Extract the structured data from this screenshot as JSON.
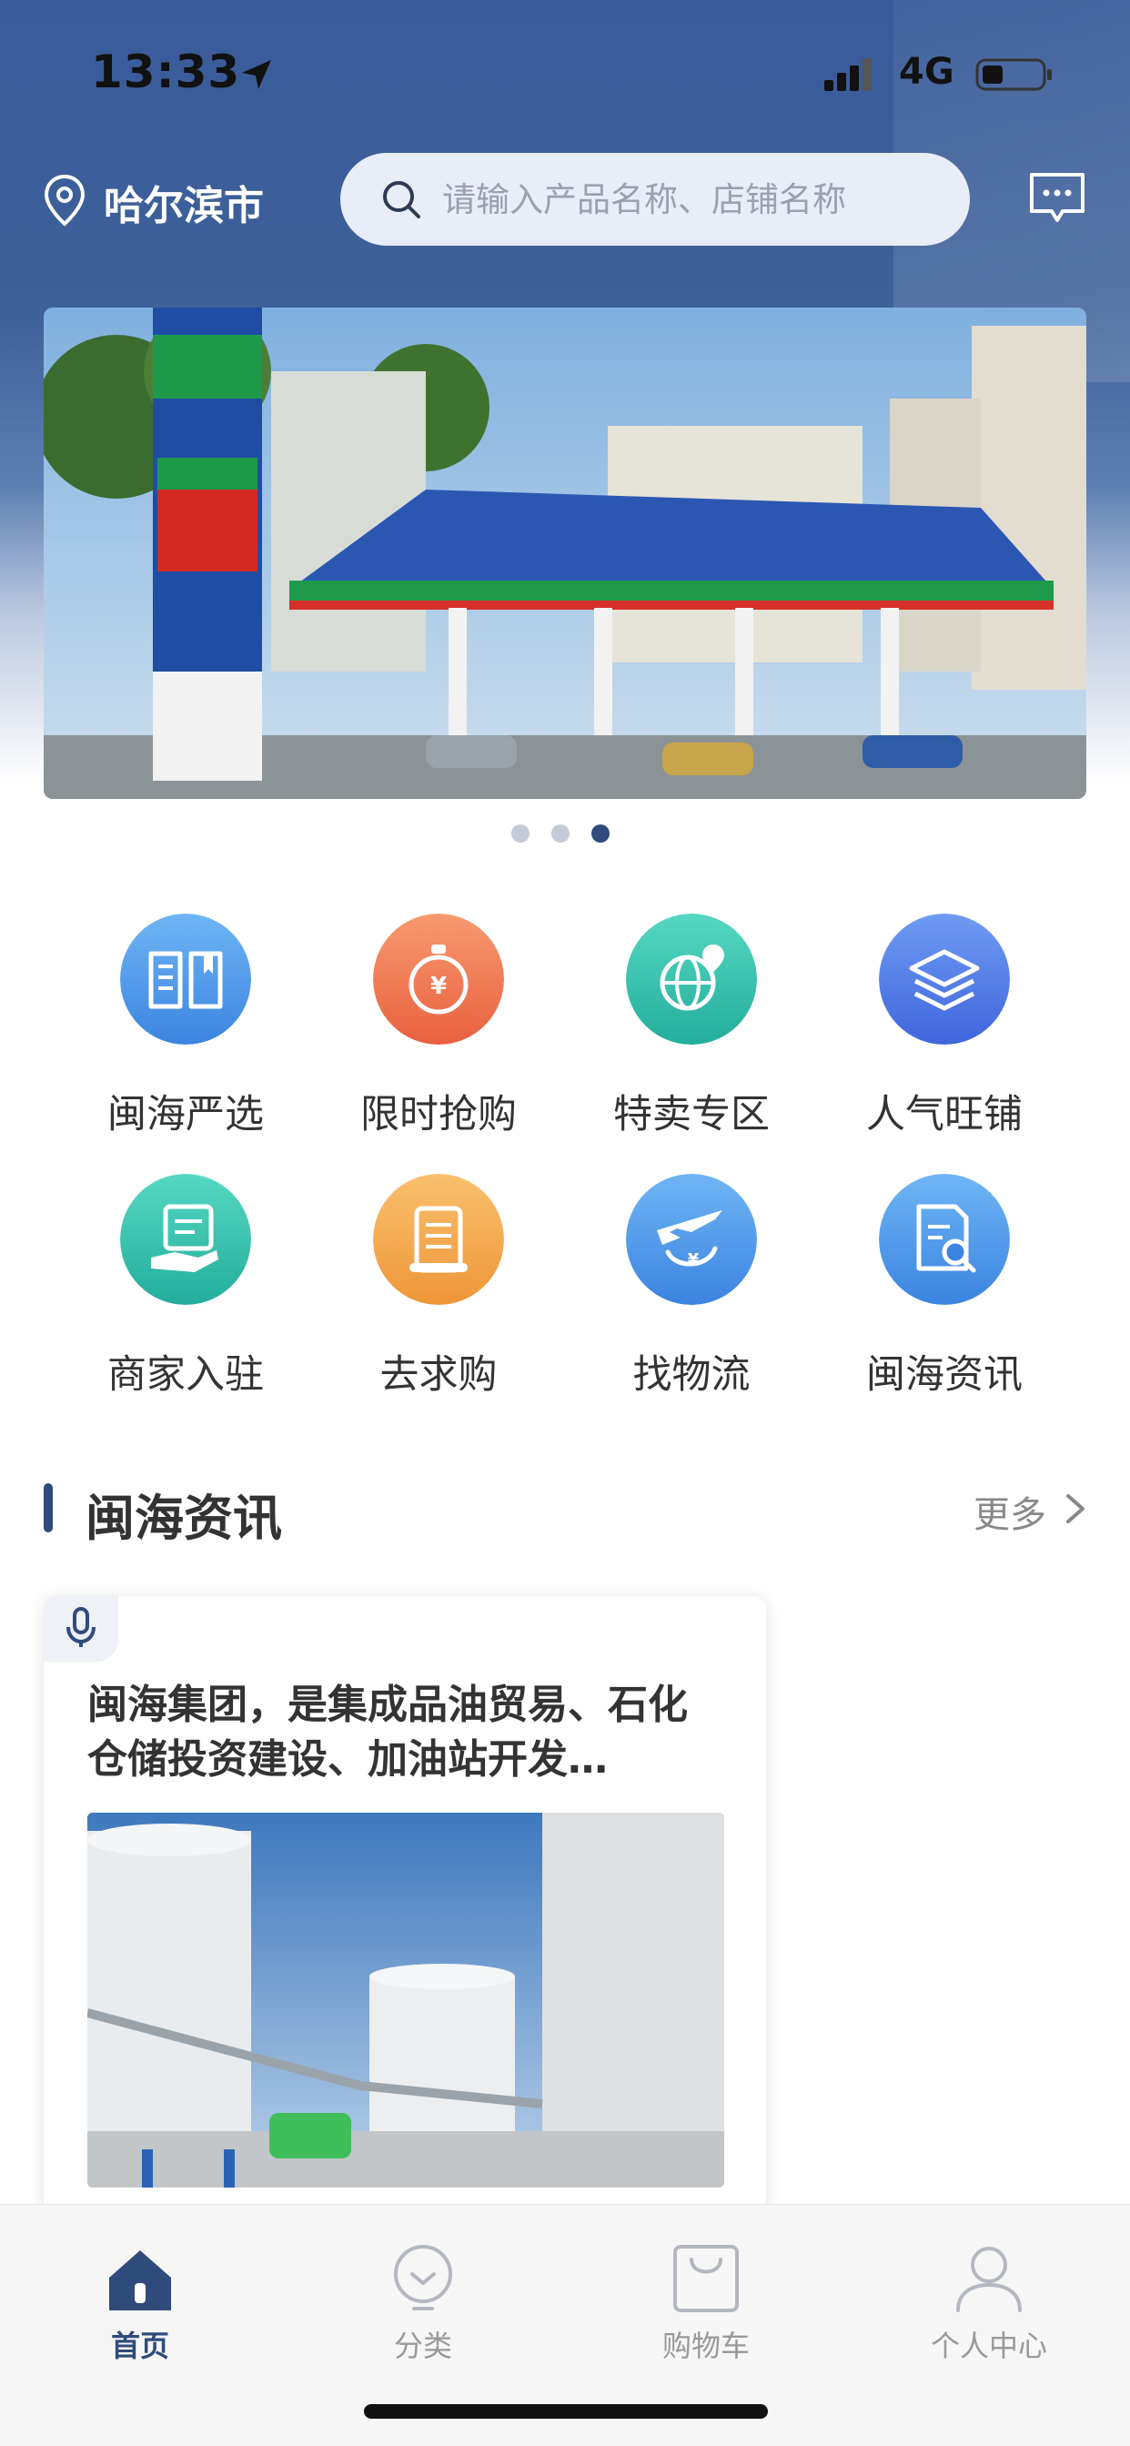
{
  "status_bar": {
    "time": "13:33",
    "network": "4G"
  },
  "header": {
    "city": "哈尔滨市",
    "search_placeholder": "请输入产品名称、店铺名称"
  },
  "banner": {
    "dots": 3,
    "active_dot": 3
  },
  "grid": [
    {
      "label": "闽海严选",
      "icon": "book-icon",
      "color": "#4a95e8"
    },
    {
      "label": "限时抢购",
      "icon": "stopwatch-yen-icon",
      "color": "#ef7b55"
    },
    {
      "label": "特卖专区",
      "icon": "globe-pin-icon",
      "color": "#33c2b0"
    },
    {
      "label": "人气旺铺",
      "icon": "layers-icon",
      "color": "#4c78e6"
    },
    {
      "label": "商家入驻",
      "icon": "hand-document-icon",
      "color": "#33c2b0"
    },
    {
      "label": "去求购",
      "icon": "scroll-icon",
      "color": "#f2a443"
    },
    {
      "label": "找物流",
      "icon": "plane-icon",
      "color": "#4a95e8"
    },
    {
      "label": "闽海资讯",
      "icon": "document-search-icon",
      "color": "#4a95e8"
    }
  ],
  "news": {
    "title": "闽海资讯",
    "more": "更多",
    "card_text": "闽海集团，是集成品油贸易、石化仓储投资建设、加油站开发…"
  },
  "tabbar": [
    {
      "label": "首页",
      "icon": "home-icon",
      "active": true
    },
    {
      "label": "分类",
      "icon": "bulb-icon",
      "active": false
    },
    {
      "label": "购物车",
      "icon": "bag-icon",
      "active": false
    },
    {
      "label": "个人中心",
      "icon": "user-icon",
      "active": false
    }
  ]
}
